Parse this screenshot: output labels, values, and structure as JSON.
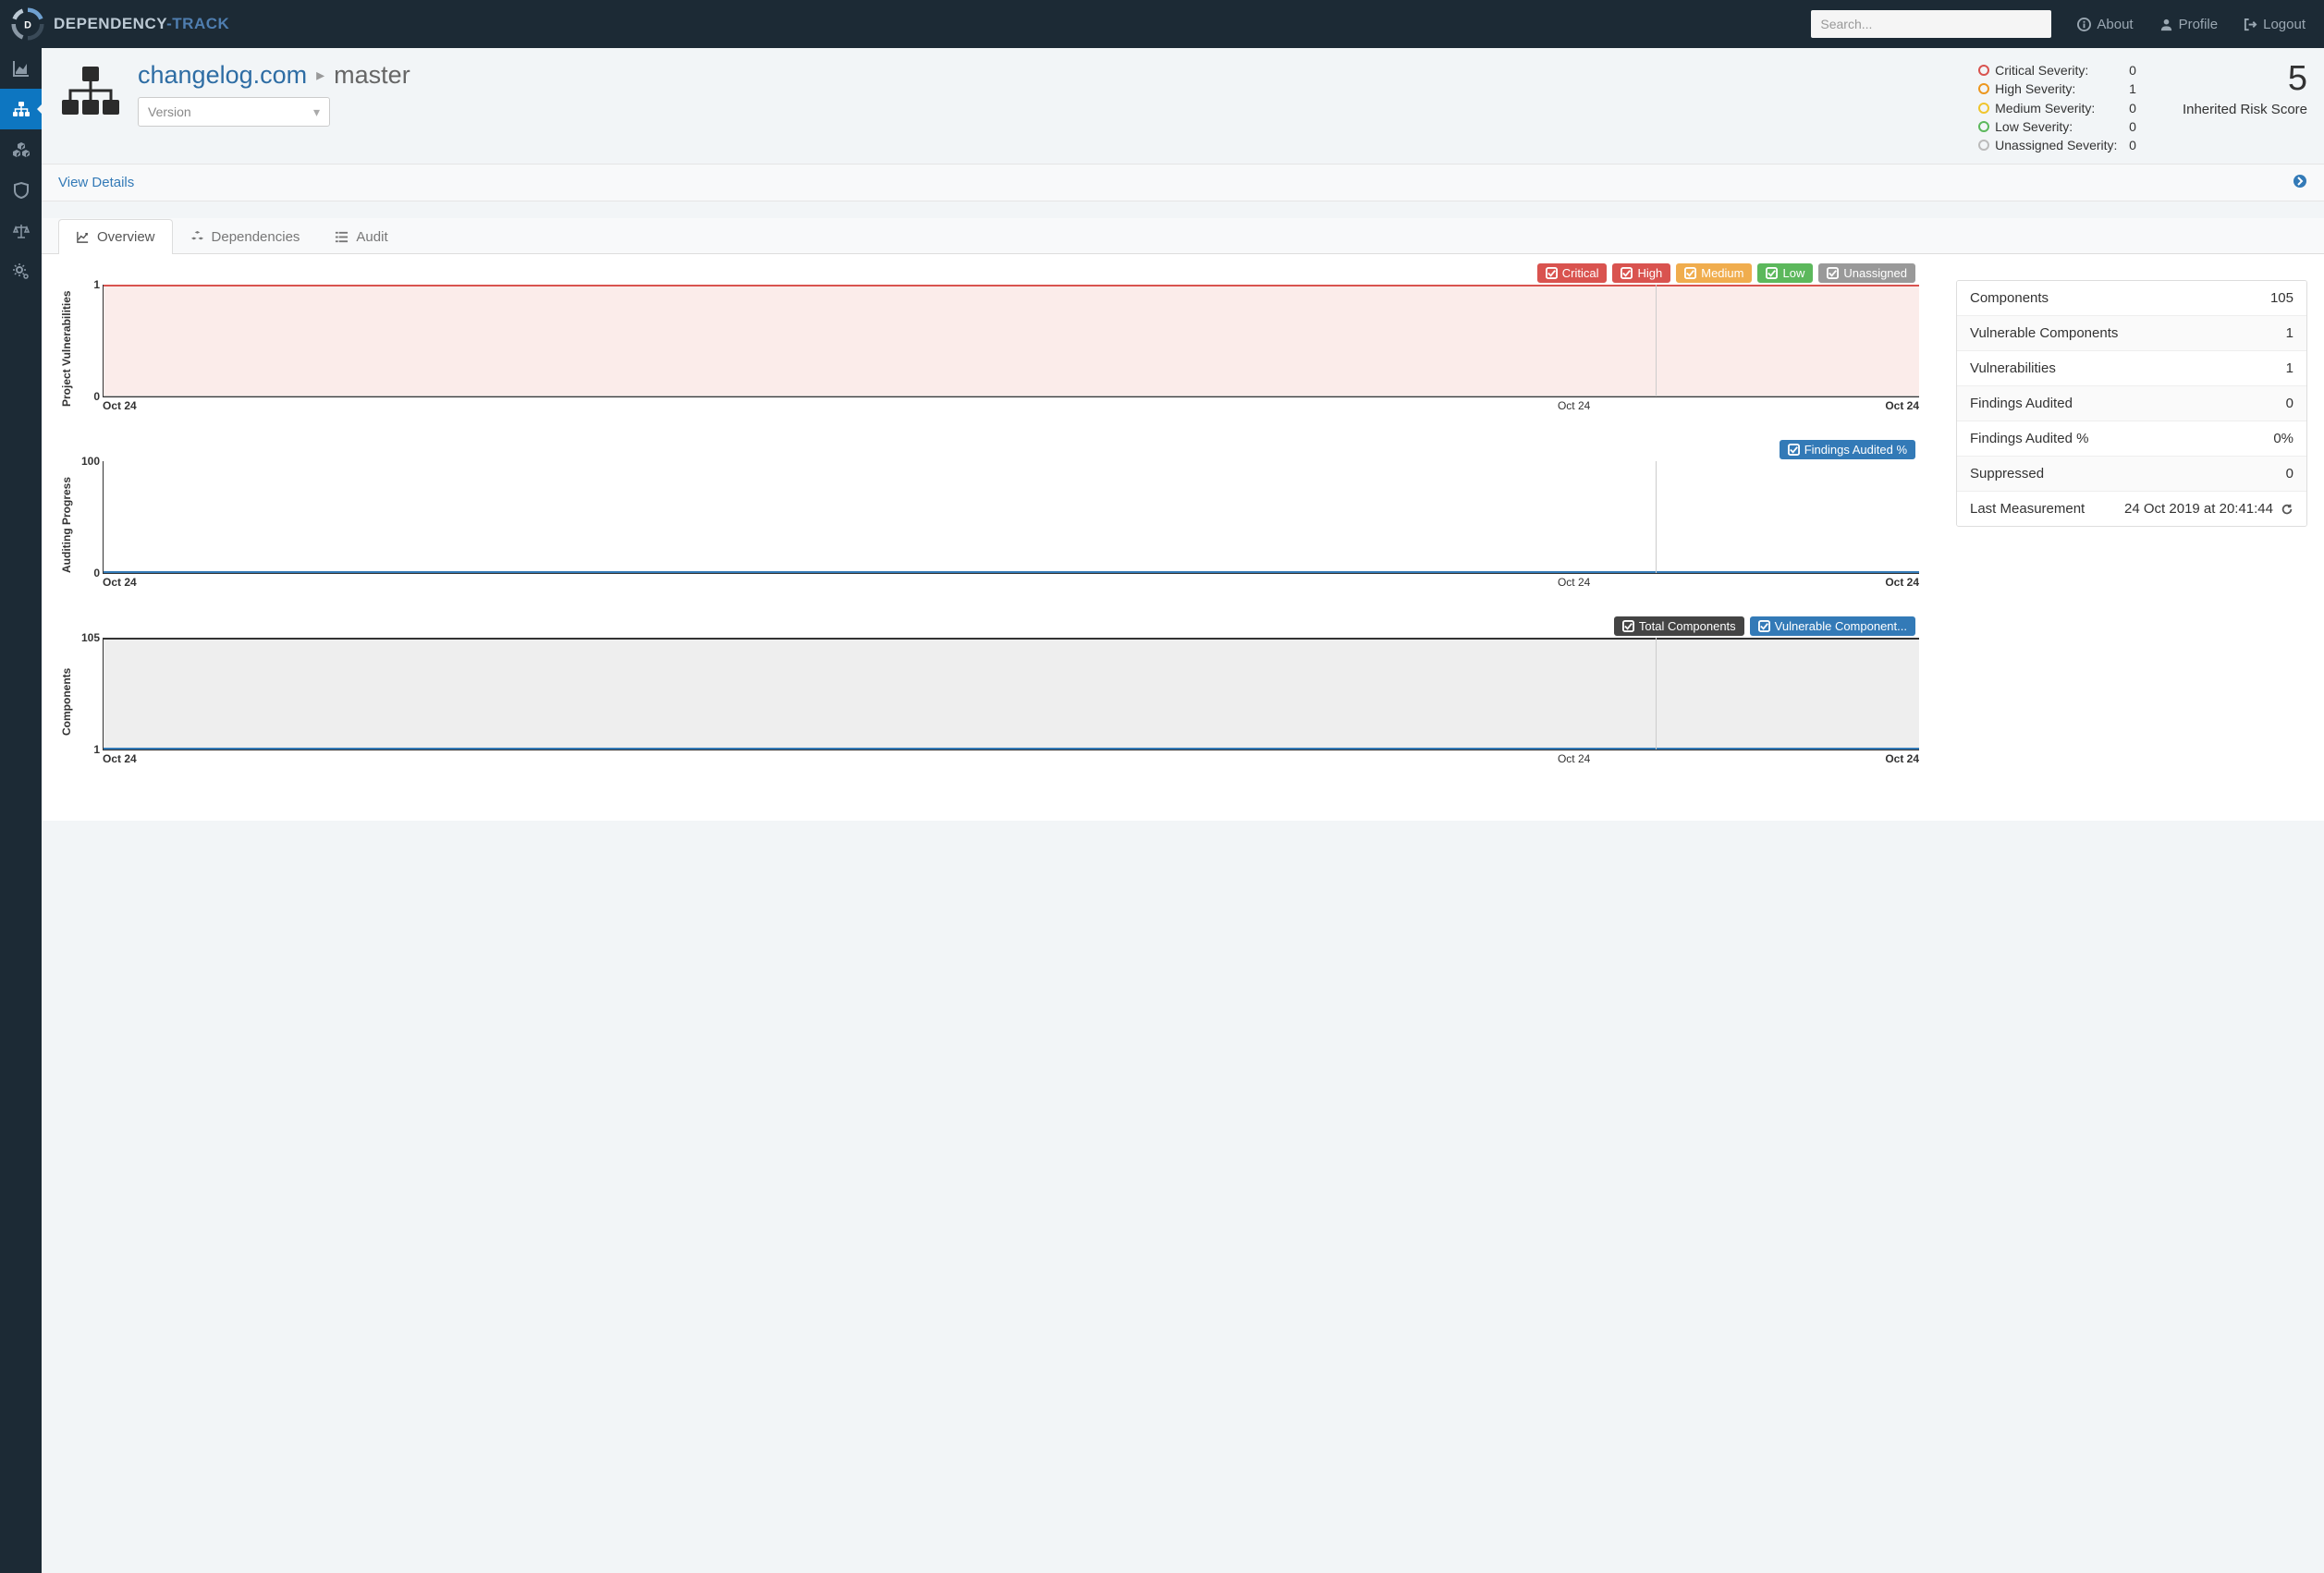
{
  "nav": {
    "brand_a": "DEPENDENCY",
    "brand_b": "-TRACK",
    "search_placeholder": "Search...",
    "about": "About",
    "profile": "Profile",
    "logout": "Logout"
  },
  "project": {
    "name": "changelog.com",
    "branch": "master",
    "version_placeholder": "Version",
    "risk_score": "5",
    "risk_label": "Inherited Risk Score",
    "view_details": "View Details"
  },
  "severity": {
    "critical": {
      "label": "Critical Severity:",
      "value": "0",
      "color": "#d9534f"
    },
    "high": {
      "label": "High Severity:",
      "value": "1",
      "color": "#ec971f"
    },
    "medium": {
      "label": "Medium Severity:",
      "value": "0",
      "color": "#f0c52e"
    },
    "low": {
      "label": "Low Severity:",
      "value": "0",
      "color": "#5cb85c"
    },
    "unassigned": {
      "label": "Unassigned Severity:",
      "value": "0",
      "color": "#bbb"
    }
  },
  "tabs": {
    "overview": "Overview",
    "dependencies": "Dependencies",
    "audit": "Audit"
  },
  "legends": {
    "critical": "Critical",
    "high": "High",
    "medium": "Medium",
    "low": "Low",
    "unassigned": "Unassigned",
    "findings_audited_pct": "Findings Audited %",
    "total_components": "Total Components",
    "vulnerable_components": "Vulnerable Component..."
  },
  "charts": {
    "vuln": {
      "ylabel": "Project Vulnerabilities",
      "ymax": "1",
      "ymin": "0",
      "x1": "Oct 24",
      "x2": "Oct 24",
      "x3": "Oct 24"
    },
    "audit": {
      "ylabel": "Auditing Progress",
      "ymax": "100",
      "ymin": "0",
      "x1": "Oct 24",
      "x2": "Oct 24",
      "x3": "Oct 24"
    },
    "comp": {
      "ylabel": "Components",
      "ymax": "105",
      "ymin": "1",
      "x1": "Oct 24",
      "x2": "Oct 24",
      "x3": "Oct 24"
    }
  },
  "chart_data": [
    {
      "type": "area",
      "title": "Project Vulnerabilities",
      "x": [
        "Oct 24",
        "Oct 24",
        "Oct 24"
      ],
      "series": [
        {
          "name": "Critical",
          "values": [
            0,
            0,
            0
          ],
          "color": "#d9534f"
        },
        {
          "name": "High",
          "values": [
            1,
            1,
            1
          ],
          "color": "#d9534f"
        },
        {
          "name": "Medium",
          "values": [
            0,
            0,
            0
          ],
          "color": "#f0ad4e"
        },
        {
          "name": "Low",
          "values": [
            0,
            0,
            0
          ],
          "color": "#5cb85c"
        },
        {
          "name": "Unassigned",
          "values": [
            0,
            0,
            0
          ],
          "color": "#999"
        }
      ],
      "ylim": [
        0,
        1
      ]
    },
    {
      "type": "line",
      "title": "Auditing Progress",
      "x": [
        "Oct 24",
        "Oct 24",
        "Oct 24"
      ],
      "series": [
        {
          "name": "Findings Audited %",
          "values": [
            0,
            0,
            0
          ],
          "color": "#337ab7"
        }
      ],
      "ylim": [
        0,
        100
      ]
    },
    {
      "type": "area",
      "title": "Components",
      "x": [
        "Oct 24",
        "Oct 24",
        "Oct 24"
      ],
      "series": [
        {
          "name": "Total Components",
          "values": [
            105,
            105,
            105
          ],
          "color": "#444"
        },
        {
          "name": "Vulnerable Components",
          "values": [
            1,
            1,
            1
          ],
          "color": "#337ab7"
        }
      ],
      "ylim": [
        1,
        105
      ]
    }
  ],
  "stats": {
    "components": {
      "label": "Components",
      "value": "105"
    },
    "vuln_components": {
      "label": "Vulnerable Components",
      "value": "1"
    },
    "vulnerabilities": {
      "label": "Vulnerabilities",
      "value": "1"
    },
    "findings_audited": {
      "label": "Findings Audited",
      "value": "0"
    },
    "findings_audited_pct": {
      "label": "Findings Audited %",
      "value": "0%"
    },
    "suppressed": {
      "label": "Suppressed",
      "value": "0"
    },
    "last_measurement": {
      "label": "Last Measurement",
      "value": "24 Oct 2019 at 20:41:44"
    }
  }
}
